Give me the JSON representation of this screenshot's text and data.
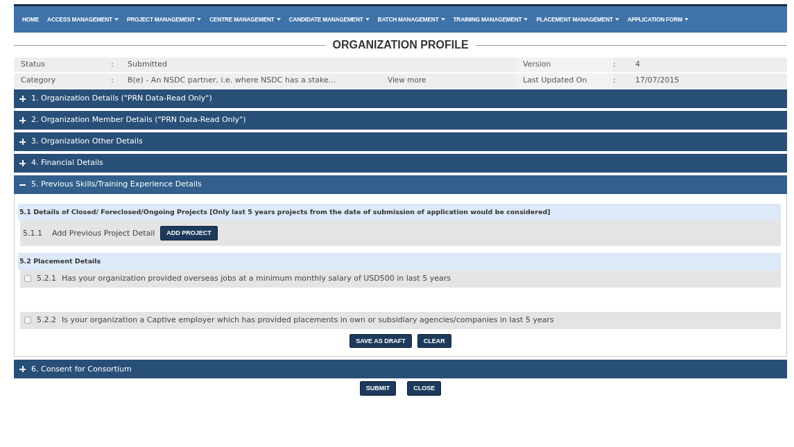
{
  "nav": [
    {
      "label": "HOME",
      "dropdown": false
    },
    {
      "label": "ACCESS MANAGEMENT",
      "dropdown": true
    },
    {
      "label": "PROJECT MANAGEMENT",
      "dropdown": true
    },
    {
      "label": "CENTRE MANAGEMENT",
      "dropdown": true
    },
    {
      "label": "CANDIDATE MANAGEMENT",
      "dropdown": true
    },
    {
      "label": "BATCH MANAGEMENT",
      "dropdown": true
    },
    {
      "label": "TRAINING MANAGEMENT",
      "dropdown": true
    },
    {
      "label": "PLACEMENT MANAGEMENT",
      "dropdown": true
    },
    {
      "label": "APPLICATION FORM",
      "dropdown": true
    }
  ],
  "page_title": "ORGANIZATION PROFILE",
  "info": {
    "status_label": "Status",
    "status_value": "Submitted",
    "version_label": "Version",
    "version_value": "4",
    "category_label": "Category",
    "category_value": "B(e) - An NSDC partner, i.e. where NSDC has a stake...",
    "view_more": "View more",
    "updated_label": "Last Updated On",
    "updated_value": "17/07/2015",
    "separator": ":"
  },
  "sections": [
    {
      "title": "1. Organization Details (\"PRN Data-Read Only\")",
      "expanded": false
    },
    {
      "title": "2. Organization Member Details (\"PRN Data-Read Only\")",
      "expanded": false
    },
    {
      "title": "3. Organization Other Details",
      "expanded": false
    },
    {
      "title": "4. Financial Details",
      "expanded": false
    },
    {
      "title": "5. Previous Skills/Training Experience Details",
      "expanded": true
    },
    {
      "title": "6. Consent for Consortium",
      "expanded": false
    }
  ],
  "details": {
    "projects_heading": "5.1 Details of Closed/ Foreclosed/Ongoing Projects [Only last 5 years projects from the date of submission of application would be considered]",
    "project_number": "5.1.1",
    "project_label": "Add Previous Project Detail",
    "add_button": "ADD PROJECT",
    "placement_heading": "5.2 Placement Details",
    "questions": [
      {
        "number": "5.2.1",
        "text": "Has your organization provided overseas jobs at a minimum monthly salary of USD500 in last 5 years",
        "checked": false
      },
      {
        "number": "5.2.2",
        "text": "Is your organization a Captive employer which has provided placements in own or subsidiary agencies/companies in last 5 years",
        "checked": false
      }
    ],
    "buttons": [
      "SAVE AS DRAFT",
      "CLEAR"
    ]
  },
  "buttons": [
    "SUBMIT",
    "CLOSE"
  ]
}
